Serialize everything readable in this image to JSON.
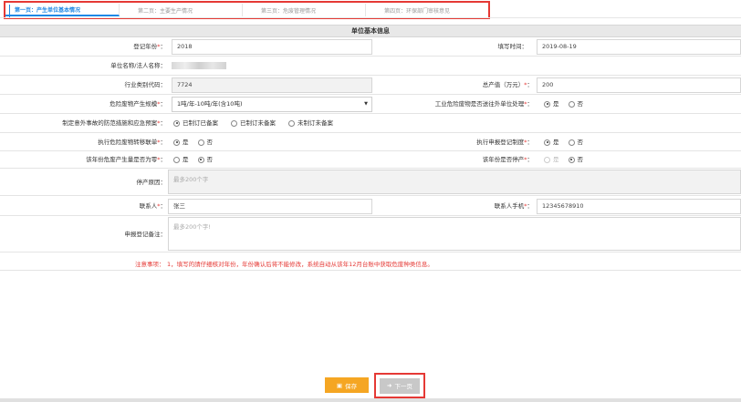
{
  "tabs": [
    "第一页：产生单位基本情况",
    "第二页：主要生产情况",
    "第三页：危废管理情况",
    "第四页：环保部门审核意见"
  ],
  "section_title": "单位基本信息",
  "fields": {
    "reg_year_label": "登记年份",
    "reg_year_value": "2018",
    "fill_time_label": "填写时间：",
    "fill_time_value": "2019-08-19",
    "unit_name_label": "单位名称/法人名称：",
    "industry_code_label": "行业类别代码：",
    "industry_code_value": "7724",
    "total_output_label": "总产值（万元）",
    "total_output_value": "200",
    "hazard_scale_label": "危险废物产生规模",
    "hazard_scale_value": "1吨/年-10吨/年(含10吨)",
    "industrial_ext_label": "工业危险废物是否送往外单位处理",
    "emergency_plan_label": "制定意外事故的防范措施和应急预案",
    "emergency_opts": [
      "已制订已备案",
      "已制订未备案",
      "未制订未备案"
    ],
    "transfer_label": "执行危险废物转移联单",
    "declare_label": "执行申报登记制度",
    "small_label": "该年份危废产生量是否为零",
    "stop_label": "该年份是否停产",
    "stop_reason_label": "停产原因：",
    "stop_reason_placeholder": "最多200个字",
    "contact_label": "联系人",
    "contact_value": "张三",
    "phone_label": "联系人手机",
    "phone_value": "12345678910",
    "remark_label": "申报登记备注：",
    "remark_placeholder": "最多200个字!",
    "yes": "是",
    "no": "否",
    "req": "*",
    "colon": "："
  },
  "notice_label": "注意事项：",
  "notice_text": "1，填写的請仔细核对年份，年份确认后将不能修改，系统自动从该年12月台账中获取危废种类信息。",
  "buttons": {
    "save": "保存",
    "next": "下一页"
  },
  "icons": {
    "save": "save-icon",
    "next": "arrow-right-icon"
  },
  "colors": {
    "accent": "#1e88e5",
    "warning": "#e53935",
    "save_btn": "#f5a623"
  }
}
